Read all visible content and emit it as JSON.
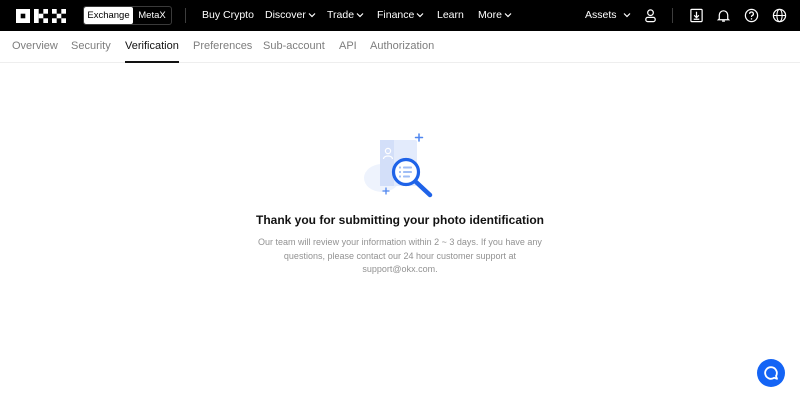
{
  "brand": {
    "logo_text": "OKX"
  },
  "topbar": {
    "switch": {
      "exchange_label": "Exchange",
      "metax_label": "MetaX"
    },
    "nav": [
      {
        "label": "Buy Crypto",
        "has_caret": false
      },
      {
        "label": "Discover",
        "has_caret": true
      },
      {
        "label": "Trade",
        "has_caret": true
      },
      {
        "label": "Finance",
        "has_caret": true
      },
      {
        "label": "Learn",
        "has_caret": false
      },
      {
        "label": "More",
        "has_caret": true
      }
    ],
    "assets_label": "Assets",
    "icons": [
      "user-icon",
      "download-icon",
      "bell-icon",
      "help-icon",
      "globe-icon"
    ]
  },
  "subnav": {
    "tabs": [
      {
        "label": "Overview"
      },
      {
        "label": "Security"
      },
      {
        "label": "Verification",
        "active": true
      },
      {
        "label": "Preferences"
      },
      {
        "label": "Sub-account"
      },
      {
        "label": "API"
      },
      {
        "label": "Authorization"
      }
    ]
  },
  "main": {
    "illustration_icon": "document-search-icon",
    "title": "Thank you for submitting your photo identification",
    "description": "Our team will review your information within 2 ~ 3 days. If you have any questions, please contact our 24 hour customer support at support@okx.com."
  },
  "chat": {
    "icon": "chat-bubble-icon"
  },
  "colors": {
    "topbar_bg": "#000000",
    "accent": "#1464f5",
    "muted_text": "#929292"
  }
}
